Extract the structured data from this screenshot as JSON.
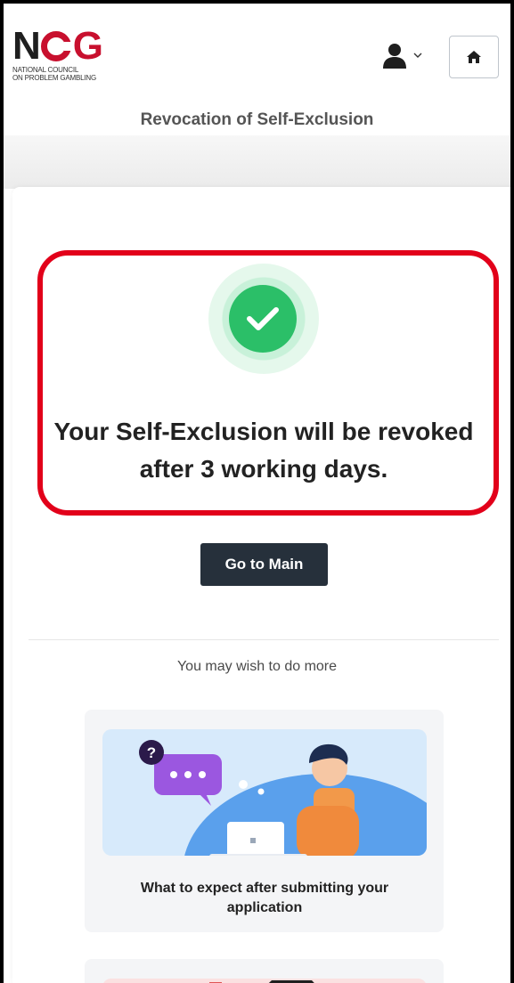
{
  "header": {
    "logo": {
      "mark_n": "N",
      "mark_g": "G",
      "line1": "NATIONAL COUNCIL",
      "line2": "ON PROBLEM GAMBLING"
    },
    "user_icon": "user-icon",
    "home_icon": "home-icon"
  },
  "page": {
    "title": "Revocation of Self-Exclusion"
  },
  "result": {
    "icon": "check-circle-icon",
    "message_line1": "Your Self-Exclusion will be revoked",
    "message_line2": "after 3 working days."
  },
  "actions": {
    "go_main_label": "Go to Main"
  },
  "more": {
    "label": "You may wish to do more",
    "tiles": [
      {
        "title": "What to expect after submitting your application"
      }
    ]
  },
  "colors": {
    "brand_red": "#c8102e",
    "success_green": "#2bbf68",
    "button_dark": "#26303b",
    "highlight_red": "#e2001a"
  }
}
